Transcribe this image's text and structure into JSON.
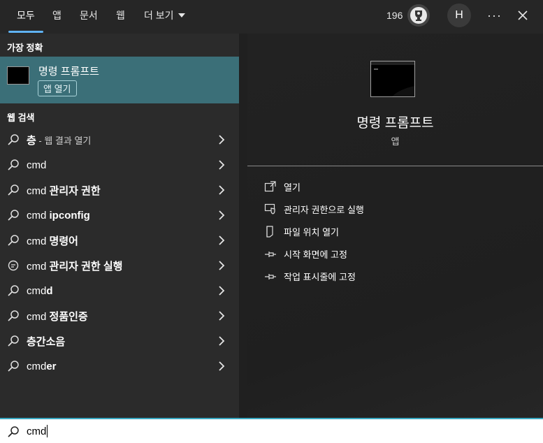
{
  "tabs": [
    "모두",
    "앱",
    "문서",
    "웹",
    "더 보기"
  ],
  "header": {
    "points": "196",
    "avatar_letter": "H",
    "more_label": "···"
  },
  "left": {
    "best_match_title": "가장 정확",
    "best_match": {
      "name": "명령 프롬프트",
      "type": "앱 열기"
    },
    "web_search_title": "웹 검색",
    "results": [
      {
        "prefix": "",
        "bold": "층",
        "suffix": " - 웹 결과 열기",
        "icon": "search-icon"
      },
      {
        "prefix": "cmd",
        "bold": "",
        "suffix": "",
        "icon": "search-icon"
      },
      {
        "prefix": "cmd ",
        "bold": "관리자 권한",
        "suffix": "",
        "icon": "search-icon"
      },
      {
        "prefix": "cmd ",
        "bold": "ipconfig",
        "suffix": "",
        "icon": "search-icon"
      },
      {
        "prefix": "cmd ",
        "bold": "명령어",
        "suffix": "",
        "icon": "search-icon"
      },
      {
        "prefix": "cmd ",
        "bold": "관리자 권한 실행",
        "suffix": "",
        "icon": "chat-icon"
      },
      {
        "prefix": "cmd",
        "bold": "d",
        "suffix": "",
        "icon": "search-icon"
      },
      {
        "prefix": "cmd ",
        "bold": "정품인증",
        "suffix": "",
        "icon": "search-icon"
      },
      {
        "prefix": "",
        "bold": "층간소음",
        "suffix": "",
        "icon": "search-icon"
      },
      {
        "prefix": "cmd",
        "bold": "er",
        "suffix": "",
        "icon": "search-icon"
      }
    ]
  },
  "detail": {
    "title": "명령 프롬프트",
    "subtitle": "앱",
    "actions": [
      {
        "label": "열기",
        "icon": "open-icon"
      },
      {
        "label": "관리자 권한으로 실행",
        "icon": "shield-icon"
      },
      {
        "label": "파일 위치 열기",
        "icon": "file-icon"
      },
      {
        "label": "시작 화면에 고정",
        "icon": "pin-icon"
      },
      {
        "label": "작업 표시줄에 고정",
        "icon": "pin-icon"
      }
    ]
  },
  "search": {
    "value": "cmd"
  }
}
